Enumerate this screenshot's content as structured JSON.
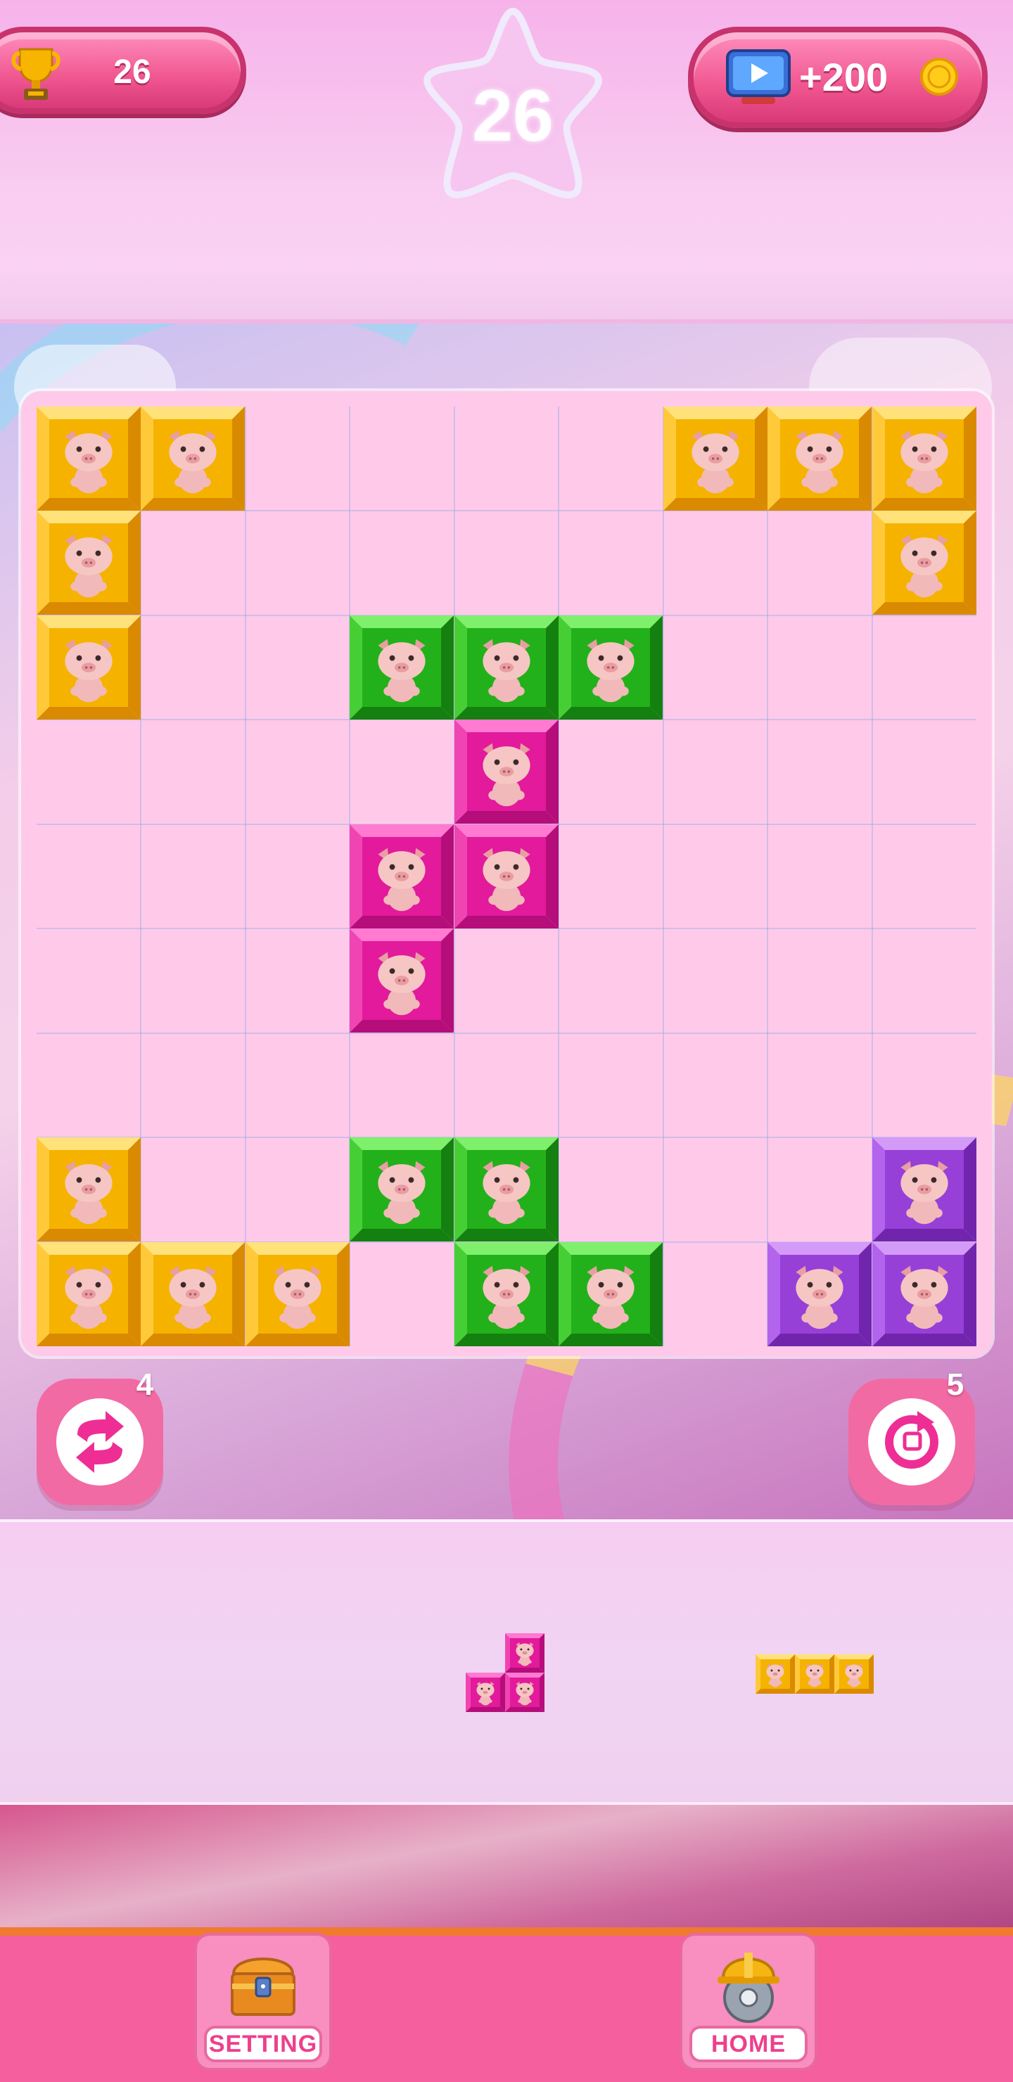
{
  "hud": {
    "score": "26",
    "level": "26",
    "coins_reward": "+200"
  },
  "icons": {
    "score": "trophy-icon",
    "coins": "tv-ad-icon",
    "coin": "coin-icon",
    "booster_left": "swap-arrows-icon",
    "booster_right": "rotate-icon",
    "setting": "treasure-chest-icon",
    "home": "helmet-saw-icon"
  },
  "colors": {
    "yellow": "#f5b300",
    "green": "#22b11a",
    "magenta": "#e21a9b",
    "purple": "#9740d8",
    "accent": "#f55f9e"
  },
  "board": {
    "size": 9,
    "cells": [
      {
        "r": 0,
        "c": 0,
        "color": "yellow"
      },
      {
        "r": 0,
        "c": 1,
        "color": "yellow"
      },
      {
        "r": 0,
        "c": 6,
        "color": "yellow"
      },
      {
        "r": 0,
        "c": 7,
        "color": "yellow"
      },
      {
        "r": 0,
        "c": 8,
        "color": "yellow"
      },
      {
        "r": 1,
        "c": 0,
        "color": "yellow"
      },
      {
        "r": 1,
        "c": 8,
        "color": "yellow"
      },
      {
        "r": 2,
        "c": 0,
        "color": "yellow"
      },
      {
        "r": 2,
        "c": 3,
        "color": "green"
      },
      {
        "r": 2,
        "c": 4,
        "color": "green"
      },
      {
        "r": 2,
        "c": 5,
        "color": "green"
      },
      {
        "r": 3,
        "c": 4,
        "color": "magenta"
      },
      {
        "r": 4,
        "c": 3,
        "color": "magenta"
      },
      {
        "r": 4,
        "c": 4,
        "color": "magenta"
      },
      {
        "r": 5,
        "c": 3,
        "color": "magenta"
      },
      {
        "r": 7,
        "c": 0,
        "color": "yellow"
      },
      {
        "r": 7,
        "c": 3,
        "color": "green"
      },
      {
        "r": 7,
        "c": 4,
        "color": "green"
      },
      {
        "r": 7,
        "c": 8,
        "color": "purple"
      },
      {
        "r": 8,
        "c": 0,
        "color": "yellow"
      },
      {
        "r": 8,
        "c": 1,
        "color": "yellow"
      },
      {
        "r": 8,
        "c": 2,
        "color": "yellow"
      },
      {
        "r": 8,
        "c": 4,
        "color": "green"
      },
      {
        "r": 8,
        "c": 5,
        "color": "green"
      },
      {
        "r": 8,
        "c": 7,
        "color": "purple"
      },
      {
        "r": 8,
        "c": 8,
        "color": "purple"
      }
    ]
  },
  "boosters": {
    "left_count": "4",
    "right_count": "5"
  },
  "tray": {
    "pieces": [
      {
        "color": "magenta",
        "cells": [
          [
            0,
            1
          ],
          [
            1,
            0
          ],
          [
            1,
            1
          ]
        ]
      },
      {
        "color": "yellow",
        "cells": [
          [
            0,
            0
          ],
          [
            0,
            1
          ],
          [
            0,
            2
          ]
        ]
      }
    ]
  },
  "nav": {
    "setting_label": "SETTING",
    "home_label": "HOME"
  }
}
